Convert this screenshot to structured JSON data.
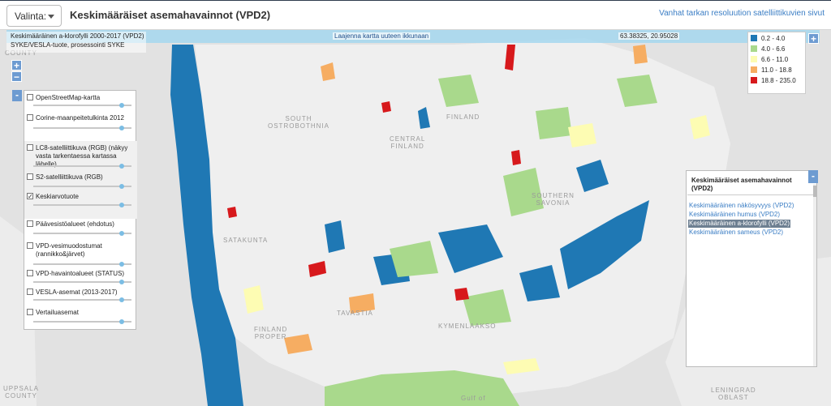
{
  "header": {
    "select_label": "Valinta:",
    "title": "Keskimääräiset asemahavainnot (VPD2)",
    "old_link": "Vanhat tarkan resoluution satelliittikuvien sivut"
  },
  "map": {
    "info_line1": "Keskimääräinen a-klorofylli 2000-2017 (VPD2)",
    "info_line2": "SYKE/VESLA-tuote, prosessointi SYKE",
    "expand_label": "Laajenna kartta uuteen ikkunaan",
    "coords": "63.38325, 20.95028",
    "zoom_in": "+",
    "zoom_out": "−",
    "corner_plus": "+",
    "places": {
      "county_top": "COUNTY",
      "finland": "FINLAND",
      "south_ostrobothnia": "SOUTH\nOSTROBOTHNIA",
      "central_finland": "CENTRAL\nFINLAND",
      "southern_savonia": "SOUTHERN\nSAVONIA",
      "satakunta": "SATAKUNTA",
      "tavastia": "TAVASTIA",
      "kymenlaakso": "KYMENLAAKSO",
      "finland_proper": "FINLAND\nPROPER",
      "uppsala": "UPPSALA\nCOUNTY",
      "gulf": "Gulf of",
      "leningrad": "LENINGRAD\nOBLAST"
    }
  },
  "legend": [
    {
      "label": "0.2 - 4.0",
      "color": "#1f78b4"
    },
    {
      "label": "4.0 - 6.6",
      "color": "#a9d98c"
    },
    {
      "label": "6.6 - 11.0",
      "color": "#fdfcb3"
    },
    {
      "label": "11.0 - 18.8",
      "color": "#f6ad62"
    },
    {
      "label": "18.8 - 235.0",
      "color": "#d7191c"
    }
  ],
  "layers": {
    "collapse": "-",
    "items": [
      {
        "label": "OpenStreetMap-kartta",
        "checked": false
      },
      {
        "label": "Corine-maanpeitetulkinta 2012",
        "checked": false
      },
      {
        "label": "LC8-satelliittikuva (RGB) (näkyy vasta tarkentaessa kartassa lähelle)",
        "checked": false
      },
      {
        "label": "S2-satelliittikuva (RGB)",
        "checked": false
      },
      {
        "label": "Keskiarvotuote",
        "checked": true
      },
      {
        "label": "Päävesistöalueet (ehdotus)",
        "checked": false
      },
      {
        "label": "VPD-vesimuodostumat (rannikko&järvet)",
        "checked": false
      },
      {
        "label": "VPD-havaintoalueet (STATUS)",
        "checked": false
      },
      {
        "label": "VESLA-asemat (2013-2017)",
        "checked": false
      },
      {
        "label": "Vertailuasemat",
        "checked": false
      }
    ],
    "check_mark": "✓"
  },
  "right_panel": {
    "title": "Keskimääräiset asemahavainnot (VPD2)",
    "collapse": "-",
    "items": [
      {
        "label": "Keskimääräinen näkösyvyys (VPD2)",
        "selected": false
      },
      {
        "label": "Keskimääräinen humus (VPD2)",
        "selected": false
      },
      {
        "label": "Keskimääräinen a-klorofylli (VPD2)",
        "selected": true
      },
      {
        "label": "Keskimääräinen sameus (VPD2)",
        "selected": false
      }
    ]
  }
}
